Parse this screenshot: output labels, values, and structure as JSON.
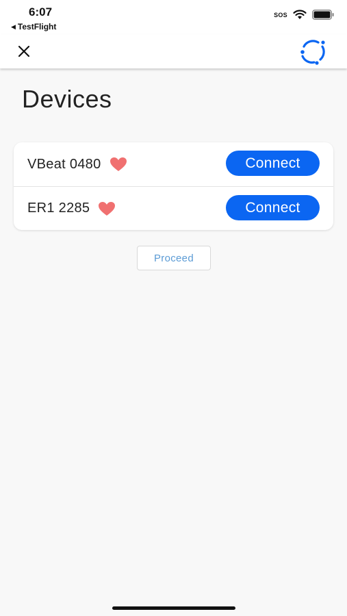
{
  "status_bar": {
    "time": "6:07",
    "back_app": "TestFlight",
    "sos_label": "SOS"
  },
  "nav": {
    "close_icon": "close-icon",
    "logo_icon": "app-logo-icon",
    "accent_color": "#0b66f2"
  },
  "page": {
    "title": "Devices"
  },
  "devices": [
    {
      "name": "VBeat 0480",
      "status_icon": "heart-icon",
      "action_label": "Connect"
    },
    {
      "name": "ER1 2285",
      "status_icon": "heart-icon",
      "action_label": "Connect"
    }
  ],
  "actions": {
    "proceed_label": "Proceed"
  },
  "colors": {
    "connect_button": "#0b66f2",
    "heart": "#f07070",
    "proceed_text": "#5b9bd5"
  }
}
